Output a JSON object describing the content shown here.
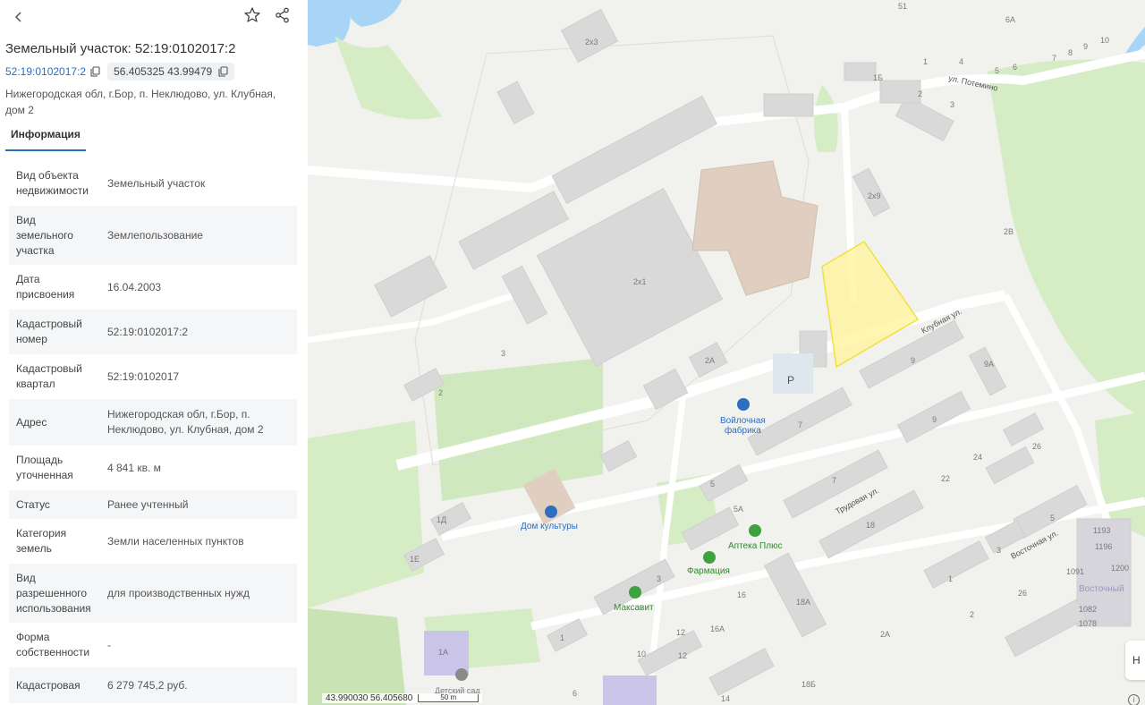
{
  "header": {
    "title": "Земельный участок: 52:19:0102017:2",
    "cad_number": "52:19:0102017:2",
    "coordinates": "56.405325 43.99479",
    "address": "Нижегородская обл, г.Бор, п. Неклюдово, ул. Клубная, дом 2"
  },
  "tabs": {
    "info": "Информация"
  },
  "info_rows": [
    {
      "label": "Вид объекта недвижимости",
      "value": "Земельный участок"
    },
    {
      "label": "Вид земельного участка",
      "value": "Землепользование"
    },
    {
      "label": "Дата присвоения",
      "value": "16.04.2003"
    },
    {
      "label": "Кадастровый номер",
      "value": "52:19:0102017:2"
    },
    {
      "label": "Кадастровый квартал",
      "value": "52:19:0102017"
    },
    {
      "label": "Адрес",
      "value": "Нижегородская обл, г.Бор, п. Неклюдово, ул. Клубная, дом 2"
    },
    {
      "label": "Площадь уточненная",
      "value": "4 841 кв. м"
    },
    {
      "label": "Статус",
      "value": "Ранее учтенный"
    },
    {
      "label": "Категория земель",
      "value": "Земли населенных пунктов"
    },
    {
      "label": "Вид разрешенного использования",
      "value": "для производственных нужд"
    },
    {
      "label": "Форма собственности",
      "value": "-"
    },
    {
      "label": "Кадастровая",
      "value": "6 279 745,2 руб."
    }
  ],
  "map": {
    "streets": {
      "klubnaya": "Клубная ул.",
      "trudovaya": "Трудовая ул.",
      "vostochnaya": "Восточная ул.",
      "potemino": "ул. Потемино"
    },
    "pois": {
      "factory_line1": "Войлочная",
      "factory_line2": "фабрика",
      "culture": "Дом культуры",
      "pharmacy_plus": "Аптека Плюс",
      "pharmacy": "Фармация",
      "maksavit": "Максавит",
      "kindergarten": "Детский сад",
      "district": "Восточный",
      "parking": "P"
    },
    "house_numbers": [
      "51",
      "6А",
      "1",
      "4",
      "5",
      "6",
      "7",
      "8",
      "9",
      "10",
      "1Б",
      "2",
      "3",
      "2х3",
      "2х9",
      "2В",
      "2х1",
      "2А",
      "9А",
      "3",
      "2",
      "9",
      "7",
      "9",
      "26",
      "24",
      "22",
      "5",
      "5А",
      "7",
      "18",
      "1Д",
      "1Е",
      "3",
      "16",
      "18А",
      "1193",
      "1196",
      "1200",
      "1091",
      "1082",
      "1078",
      "5",
      "3",
      "1",
      "26",
      "2",
      "2А",
      "1А",
      "12",
      "16А",
      "10",
      "6",
      "14",
      "18Б",
      "1",
      "12"
    ],
    "scale_coords": "43.990030  56.405680",
    "scale_label": "50 m",
    "h_button": "Н",
    "info_glyph": "i"
  },
  "colors": {
    "accent": "#2d6ec0",
    "parcel": "#fff59d",
    "green": "#d6ecc4",
    "water": "#a8d4f5",
    "building": "#d9d9d9"
  }
}
